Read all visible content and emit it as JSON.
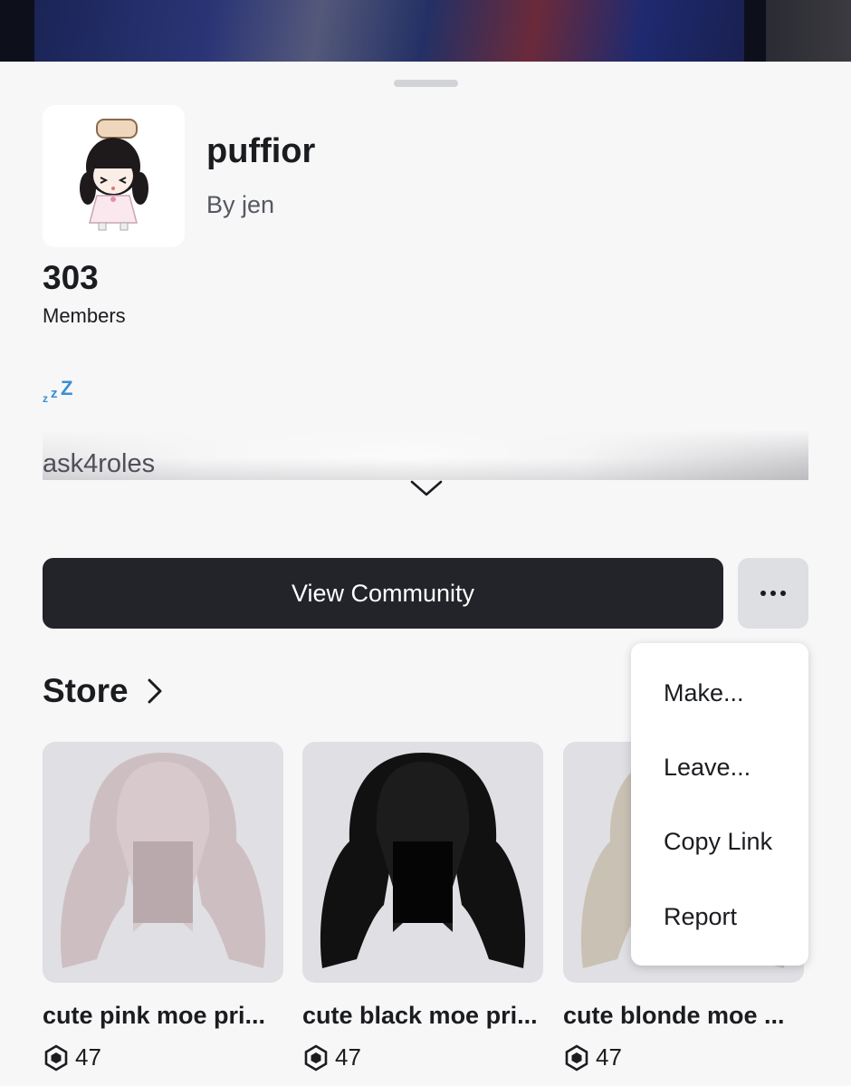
{
  "community": {
    "name": "puffior",
    "owner": "By jen",
    "member_count": "303",
    "member_label": "Members",
    "status_emoji": "zzz-icon",
    "description": "ask4roles"
  },
  "actions": {
    "view_community": "View Community",
    "more": "more-options-icon"
  },
  "menu": {
    "items": [
      "Make...",
      "Leave...",
      "Copy Link",
      "Report"
    ]
  },
  "store": {
    "title": "Store",
    "items": [
      {
        "name": "cute pink moe pri...",
        "price": "47",
        "hair_color": "#cdbfc1"
      },
      {
        "name": "cute black moe pri...",
        "price": "47",
        "hair_color": "#111111"
      },
      {
        "name": "cute blonde moe ...",
        "price": "47",
        "hair_color": "#c9c1b3"
      }
    ]
  },
  "colors": {
    "primary_button": "#22242a",
    "background": "#f7f7f8"
  }
}
